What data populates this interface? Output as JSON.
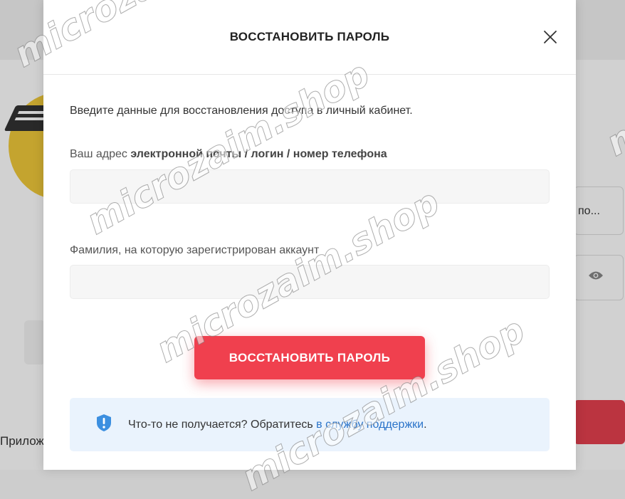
{
  "background": {
    "field_text": "по...",
    "bottom_text": "Прилож"
  },
  "modal": {
    "title": "ВОССТАНОВИТЬ ПАРОЛЬ",
    "intro": "Введите данные для восстановления доступа в личный кабинет.",
    "field1": {
      "label_prefix": "Ваш адрес ",
      "label_bold": "электронной почты / логин / номер телефона",
      "value": "",
      "placeholder": ""
    },
    "field2": {
      "label": "Фамилия, на которую зарегистрирован аккаунт",
      "value": "",
      "placeholder": ""
    },
    "submit_label": "ВОССТАНОВИТЬ ПАРОЛЬ",
    "help": {
      "text": "Что-то не получается? Обратитесь ",
      "link": "в службу поддержки",
      "suffix": "."
    }
  },
  "watermark": "microzaim.shop",
  "colors": {
    "primary_button": "#f0404e",
    "help_bg": "#eaf3fd",
    "link": "#2a73c9",
    "info_icon": "#3c8fe0"
  },
  "icons": {
    "close": "close-icon",
    "info": "info-shield-icon",
    "eye": "eye-icon"
  }
}
